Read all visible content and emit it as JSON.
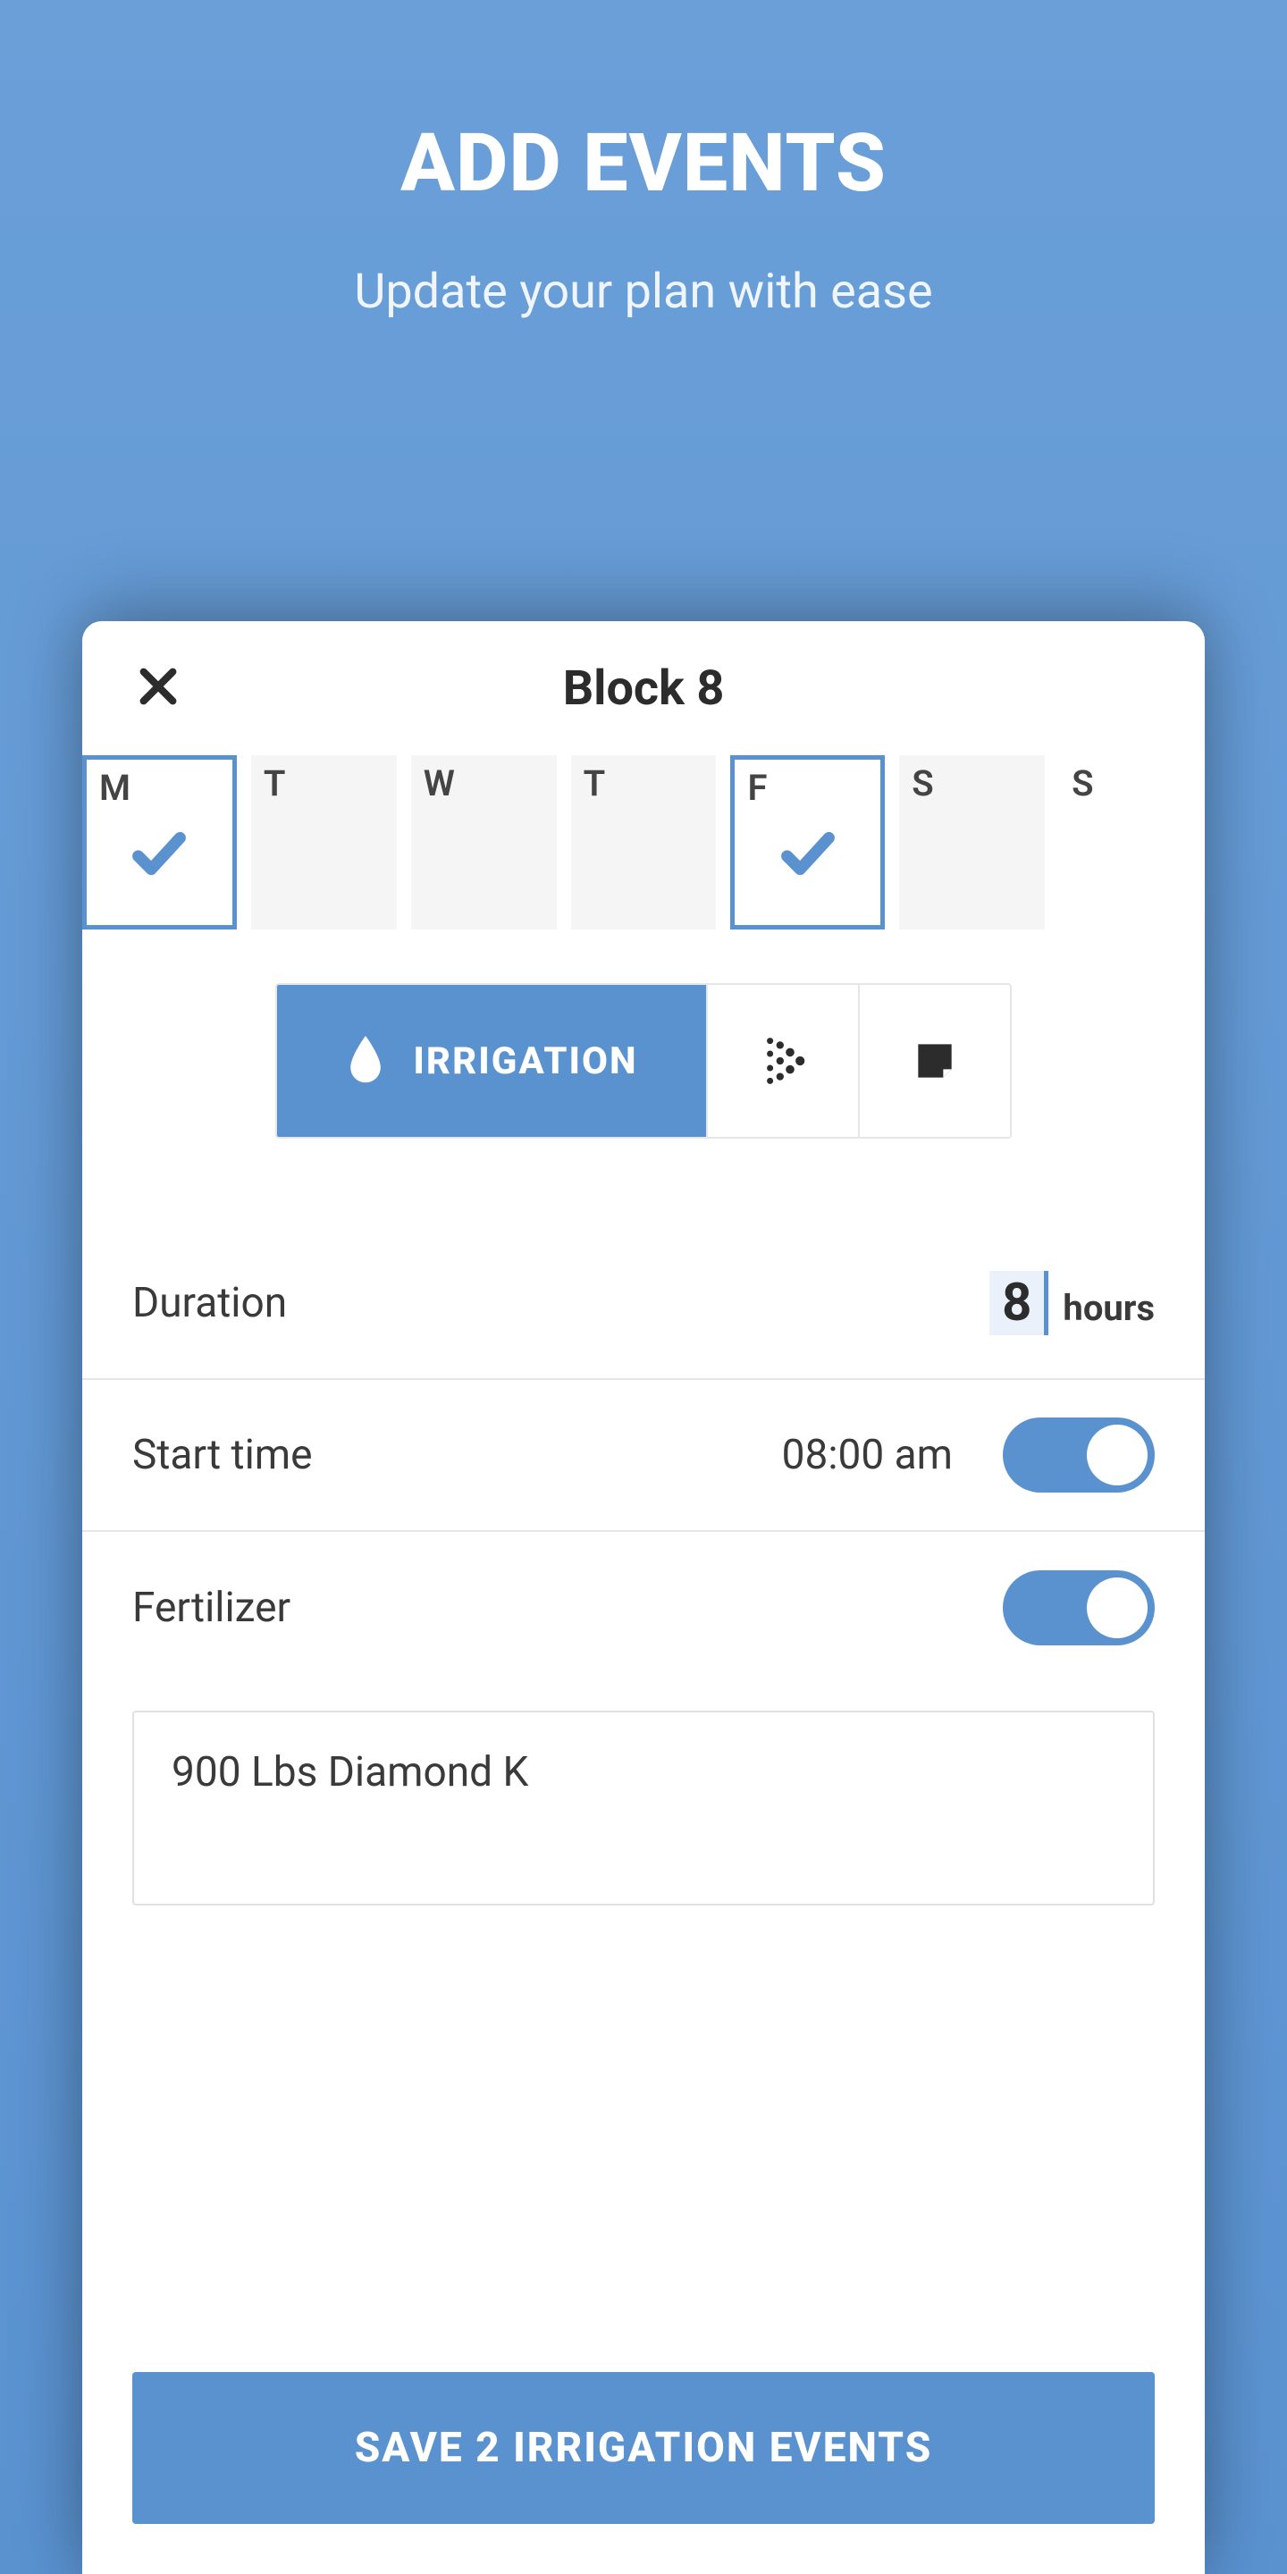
{
  "header": {
    "title": "ADD EVENTS",
    "subtitle": "Update your plan with ease"
  },
  "card": {
    "title": "Block 8",
    "days": [
      {
        "label": "M",
        "selected": true
      },
      {
        "label": "T",
        "selected": false
      },
      {
        "label": "W",
        "selected": false
      },
      {
        "label": "T",
        "selected": false
      },
      {
        "label": "F",
        "selected": true
      },
      {
        "label": "S",
        "selected": false
      },
      {
        "label": "S",
        "selected": false
      }
    ],
    "tabs": {
      "irrigation_label": "IRRIGATION",
      "active": "irrigation"
    },
    "duration": {
      "label": "Duration",
      "value": "8",
      "unit": "hours"
    },
    "start_time": {
      "label": "Start time",
      "value": "08:00 am",
      "enabled": true
    },
    "fertilizer": {
      "label": "Fertilizer",
      "enabled": true,
      "text": "900 Lbs Diamond K"
    },
    "save_label": "SAVE 2 IRRIGATION EVENTS"
  },
  "colors": {
    "accent": "#5a92d0"
  }
}
